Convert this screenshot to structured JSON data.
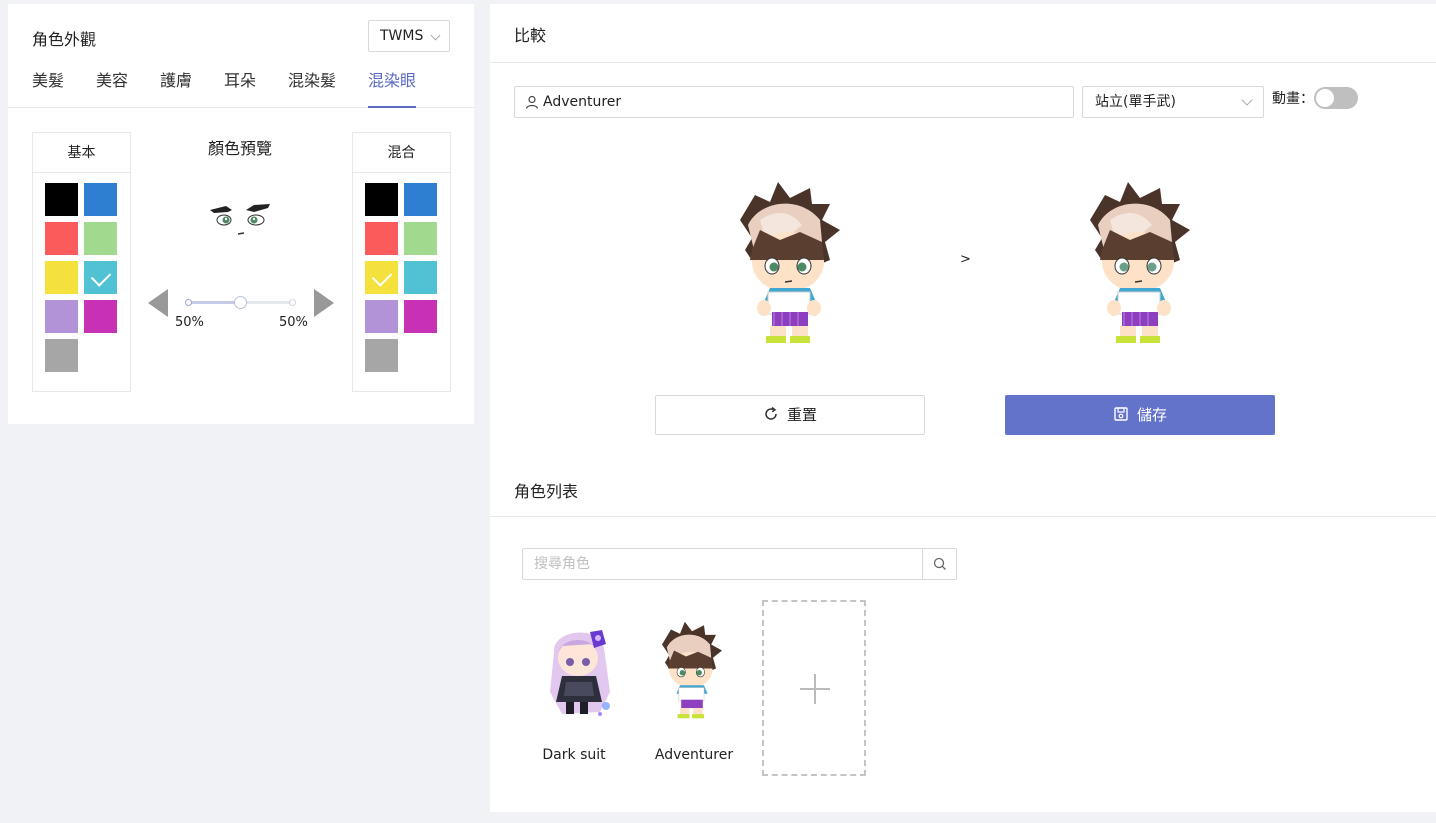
{
  "appearance": {
    "title": "角色外觀",
    "region": "TWMS",
    "tabs": [
      "美髮",
      "美容",
      "護膚",
      "耳朵",
      "混染髮",
      "混染眼"
    ],
    "active_tab": "混染眼",
    "base_header": "基本",
    "mix_header": "混合",
    "preview_title": "顏色預覽",
    "base_pct": "50%",
    "mix_pct": "50%",
    "blend_ratio": 0.5,
    "base_selected": "cyan",
    "mix_selected": "yellow",
    "swatch_colors": {
      "black": "#000000",
      "blue": "#2e7fd2",
      "red": "#fb5b5b",
      "green": "#a1d98e",
      "yellow": "#f5e13b",
      "cyan": "#51c2d3",
      "purple": "#b393d8",
      "magenta": "#c831b5",
      "gray": "#a6a6a6"
    }
  },
  "compare": {
    "title": "比較",
    "character_name": "Adventurer",
    "pose": "站立(單手武)",
    "animation_label": "動畫：",
    "animation_on": false,
    "arrow": ">",
    "reset_label": "重置",
    "save_label": "儲存",
    "accent": "#6373c9"
  },
  "character_list": {
    "title": "角色列表",
    "search_placeholder": "搜尋角色",
    "characters": [
      {
        "name": "Dark suit"
      },
      {
        "name": "Adventurer"
      }
    ]
  }
}
